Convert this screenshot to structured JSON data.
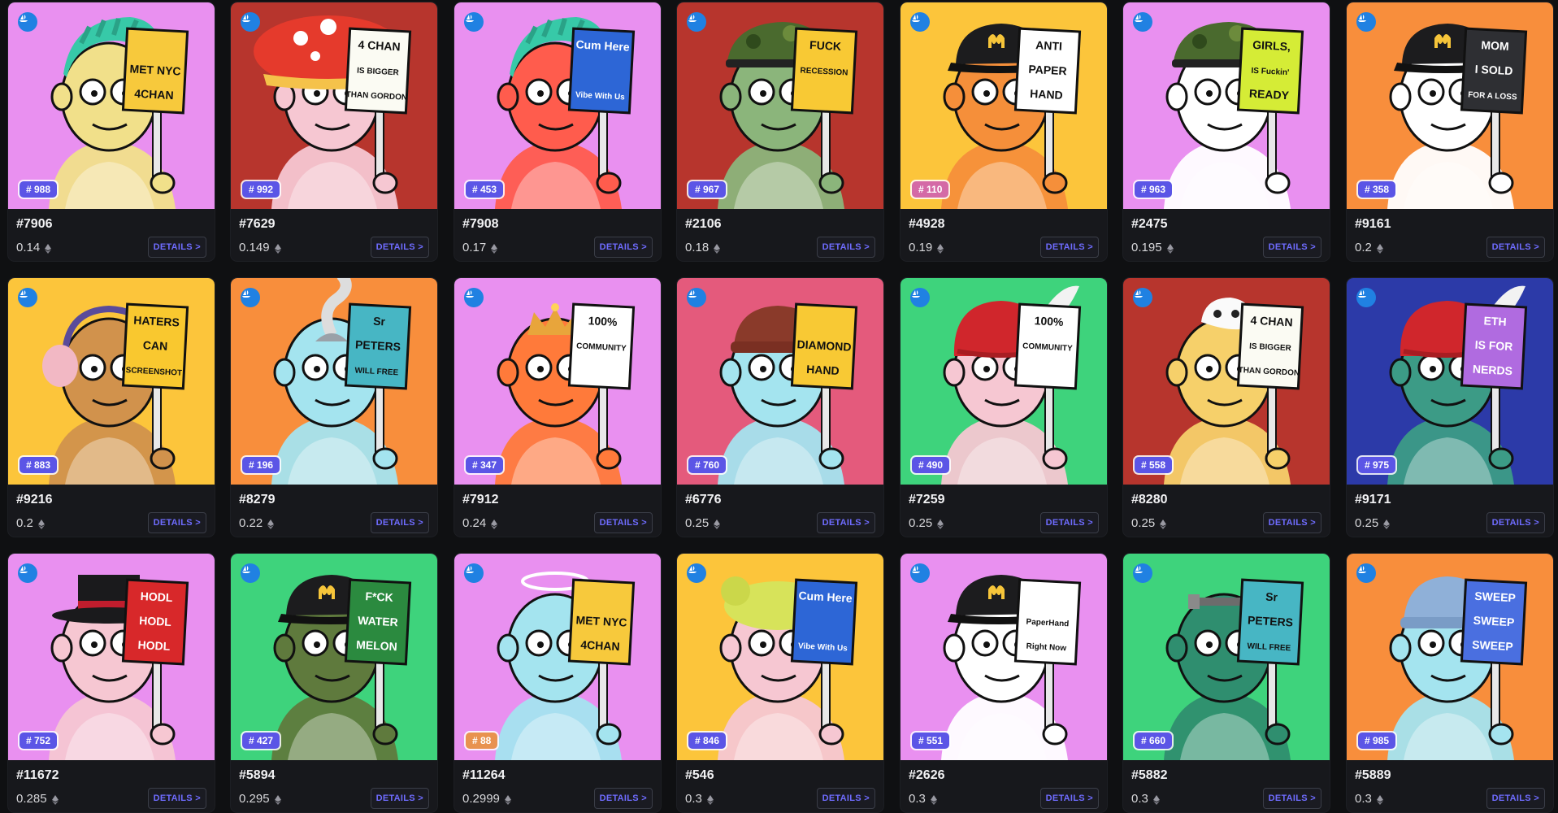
{
  "details_label": "DETAILS >",
  "cards": [
    {
      "id": "#7906",
      "price": "0.14",
      "rank": "# 988",
      "bg": "#e990f0",
      "badge": "normal",
      "skin": "#f1e08a",
      "hat": "mohawk",
      "sign": [
        "",
        "MET NYC",
        "4CHAN"
      ],
      "signbg": "#f7c93c"
    },
    {
      "id": "#7629",
      "price": "0.149",
      "rank": "# 992",
      "bg": "#b7352d",
      "badge": "normal",
      "skin": "#f6c7d2",
      "hat": "mushroom",
      "sign": [
        "4 CHAN",
        "IS BIGGER",
        "THAN GORDON"
      ],
      "signbg": "#fbfbf3"
    },
    {
      "id": "#7908",
      "price": "0.17",
      "rank": "# 453",
      "bg": "#e990f0",
      "badge": "normal",
      "skin": "#ff5c4d",
      "hat": "mohawk",
      "sign": [
        "Cum Here",
        "",
        "Vibe With Us"
      ],
      "signbg": "#2d66d6"
    },
    {
      "id": "#2106",
      "price": "0.18",
      "rank": "# 967",
      "bg": "#b7352d",
      "badge": "normal",
      "skin": "#8bb57b",
      "hat": "camo",
      "sign": [
        "FUCK",
        "RECESSION",
        ""
      ],
      "signbg": "#f8c934"
    },
    {
      "id": "#4928",
      "price": "0.19",
      "rank": "# 110",
      "bg": "#fcc53b",
      "badge": "alt",
      "skin": "#f58f3a",
      "hat": "cap",
      "sign": [
        "ANTI",
        "PAPER",
        "HAND"
      ],
      "signbg": "#ffffff"
    },
    {
      "id": "#2475",
      "price": "0.195",
      "rank": "# 963",
      "bg": "#e990f0",
      "badge": "normal",
      "skin": "#ffffff",
      "hat": "camo",
      "sign": [
        "GIRLS,",
        "IS Fuckin'",
        "READY"
      ],
      "signbg": "#d5ec36"
    },
    {
      "id": "#9161",
      "price": "0.2",
      "rank": "# 358",
      "bg": "#f88e3c",
      "badge": "normal",
      "skin": "#ffffff",
      "hat": "cap",
      "sign": [
        "MOM",
        "I SOLD",
        "FOR A LOSS"
      ],
      "signbg": "#2e2f33"
    },
    {
      "id": "#9216",
      "price": "0.2",
      "rank": "# 883",
      "bg": "#fcc53b",
      "badge": "normal",
      "skin": "#d1924c",
      "hat": "earmuff",
      "sign": [
        "HATERS",
        "CAN",
        "SCREENSHOT"
      ],
      "signbg": "#f9c82f"
    },
    {
      "id": "#8279",
      "price": "0.22",
      "rank": "# 196",
      "bg": "#f88e3c",
      "badge": "normal",
      "skin": "#a4e4ef",
      "hat": "smoke",
      "sign": [
        "Sr",
        "PETERS",
        "WILL FREE"
      ],
      "signbg": "#47b6c4"
    },
    {
      "id": "#7912",
      "price": "0.24",
      "rank": "# 347",
      "bg": "#e990f0",
      "badge": "normal",
      "skin": "#ff7a3a",
      "hat": "crown",
      "sign": [
        "100%",
        "COMMUNITY",
        ""
      ],
      "signbg": "#ffffff"
    },
    {
      "id": "#6776",
      "price": "0.25",
      "rank": "# 760",
      "bg": "#e45a7c",
      "badge": "normal",
      "skin": "#a4e4ef",
      "hat": "beanie",
      "sign": [
        "",
        "DIAMOND",
        "HAND"
      ],
      "signbg": "#f8c934"
    },
    {
      "id": "#7259",
      "price": "0.25",
      "rank": "# 490",
      "bg": "#3ed37c",
      "badge": "normal",
      "skin": "#f6c7d2",
      "hat": "feather",
      "sign": [
        "100%",
        "COMMUNITY",
        ""
      ],
      "signbg": "#ffffff"
    },
    {
      "id": "#8280",
      "price": "0.25",
      "rank": "# 558",
      "bg": "#b7352d",
      "badge": "normal",
      "skin": "#f6d06a",
      "hat": "skull",
      "sign": [
        "4 CHAN",
        "IS BIGGER",
        "THAN GORDON"
      ],
      "signbg": "#fbfbf3"
    },
    {
      "id": "#9171",
      "price": "0.25",
      "rank": "# 975",
      "bg": "#2c3aa8",
      "badge": "normal",
      "skin": "#3c9b86",
      "hat": "feather",
      "sign": [
        "ETH",
        "IS FOR",
        "NERDS"
      ],
      "signbg": "#b06be0"
    },
    {
      "id": "#11672",
      "price": "0.285",
      "rank": "# 752",
      "bg": "#e990f0",
      "badge": "normal",
      "skin": "#f6c7d2",
      "hat": "tophat",
      "sign": [
        "HODL",
        "HODL",
        "HODL"
      ],
      "signbg": "#d8282a"
    },
    {
      "id": "#5894",
      "price": "0.295",
      "rank": "# 427",
      "bg": "#3ed37c",
      "badge": "normal",
      "skin": "#5f7a3d",
      "hat": "cap",
      "sign": [
        "F*CK",
        "WATER",
        "MELON"
      ],
      "signbg": "#2b8a3f"
    },
    {
      "id": "#11264",
      "price": "0.2999",
      "rank": "# 88",
      "bg": "#e990f0",
      "badge": "gold",
      "skin": "#a4e4ef",
      "hat": "halo",
      "sign": [
        "",
        "MET NYC",
        "4CHAN"
      ],
      "signbg": "#f7c93c"
    },
    {
      "id": "#546",
      "price": "0.3",
      "rank": "# 846",
      "bg": "#fcc53b",
      "badge": "normal",
      "skin": "#f6c7d2",
      "hat": "bun",
      "sign": [
        "Cum Here",
        "",
        "Vibe With Us"
      ],
      "signbg": "#2d66d6"
    },
    {
      "id": "#2626",
      "price": "0.3",
      "rank": "# 551",
      "bg": "#e990f0",
      "badge": "normal",
      "skin": "#ffffff",
      "hat": "cap",
      "sign": [
        "",
        "PaperHand",
        "Right Now"
      ],
      "signbg": "#ffffff"
    },
    {
      "id": "#5882",
      "price": "0.3",
      "rank": "# 660",
      "bg": "#3ed37c",
      "badge": "normal",
      "skin": "#2f8e6f",
      "hat": "bolt",
      "sign": [
        "Sr",
        "PETERS",
        "WILL FREE"
      ],
      "signbg": "#47b6c4"
    },
    {
      "id": "#5889",
      "price": "0.3",
      "rank": "# 985",
      "bg": "#f88e3c",
      "badge": "normal",
      "skin": "#a4e4ef",
      "hat": "beanie2",
      "sign": [
        "SWEEP",
        "SWEEP",
        "SWEEP"
      ],
      "signbg": "#4a6fe0"
    }
  ]
}
